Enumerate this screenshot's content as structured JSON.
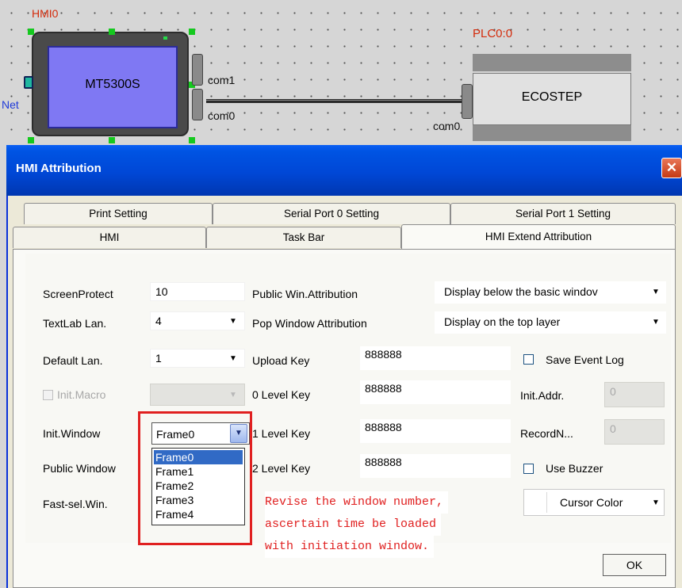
{
  "diagram": {
    "hmi_label": "HMI0",
    "hmi_model": "MT5300S",
    "net_label": "Net",
    "hmi_port_com1": "com1",
    "hmi_port_com0": "com0",
    "plc_label": "PLC0:0",
    "plc_name": "ECOSTEP",
    "plc_port": "com0"
  },
  "dialog": {
    "title": "HMI Attribution",
    "close_glyph": "✕",
    "tabs_row1": [
      {
        "label": "Print Setting"
      },
      {
        "label": "Serial Port 0 Setting"
      },
      {
        "label": "Serial Port 1 Setting"
      }
    ],
    "tabs_row2": [
      {
        "label": "HMI"
      },
      {
        "label": "Task Bar"
      },
      {
        "label": "HMI Extend Attribution",
        "active": true
      }
    ],
    "left_fields": {
      "screen_protect": {
        "label": "ScreenProtect",
        "value": "10"
      },
      "textlab_lan": {
        "label": "TextLab Lan.",
        "value": "4"
      },
      "default_lan": {
        "label": "Default Lan.",
        "value": "1"
      },
      "init_macro": {
        "label": "Init.Macro",
        "value": "",
        "checked": false,
        "disabled": true
      },
      "init_window": {
        "label": "Init.Window",
        "value": "Frame0"
      },
      "public_window": {
        "label": "Public Window"
      },
      "fast_sel_win": {
        "label": "Fast-sel.Win."
      }
    },
    "window_list": [
      "Frame0",
      "Frame1",
      "Frame2",
      "Frame3",
      "Frame4"
    ],
    "window_list_selected": "Frame0",
    "middle_fields": {
      "public_win_attr": {
        "label": "Public Win.Attribution",
        "value": "Display below the basic windov"
      },
      "pop_window_attr": {
        "label": "Pop Window Attribution",
        "value": "Display on the top layer"
      },
      "upload_key": {
        "label": "Upload Key",
        "value": "888888"
      },
      "level0_key": {
        "label": "0 Level Key",
        "value": "888888"
      },
      "level1_key": {
        "label": "1 Level Key",
        "value": "888888"
      },
      "level2_key": {
        "label": "2 Level Key",
        "value": "888888"
      }
    },
    "right_fields": {
      "save_event_log": {
        "label": "Save Event Log",
        "checked": false
      },
      "init_addr": {
        "label": "Init.Addr.",
        "value": "0"
      },
      "record_n": {
        "label": "RecordN...",
        "value": "0"
      },
      "use_buzzer": {
        "label": "Use Buzzer",
        "checked": false
      },
      "cursor_color": {
        "label": "Cursor Color"
      }
    },
    "annotation": [
      "Revise the window number,",
      "ascertain time be loaded",
      "with initiation window."
    ],
    "ok_label": "OK",
    "colors": {
      "title_blue": "#0054e3",
      "annotation_red": "#e02020",
      "hmi_screen": "#7f78f3",
      "selection": "#316ac5"
    }
  }
}
